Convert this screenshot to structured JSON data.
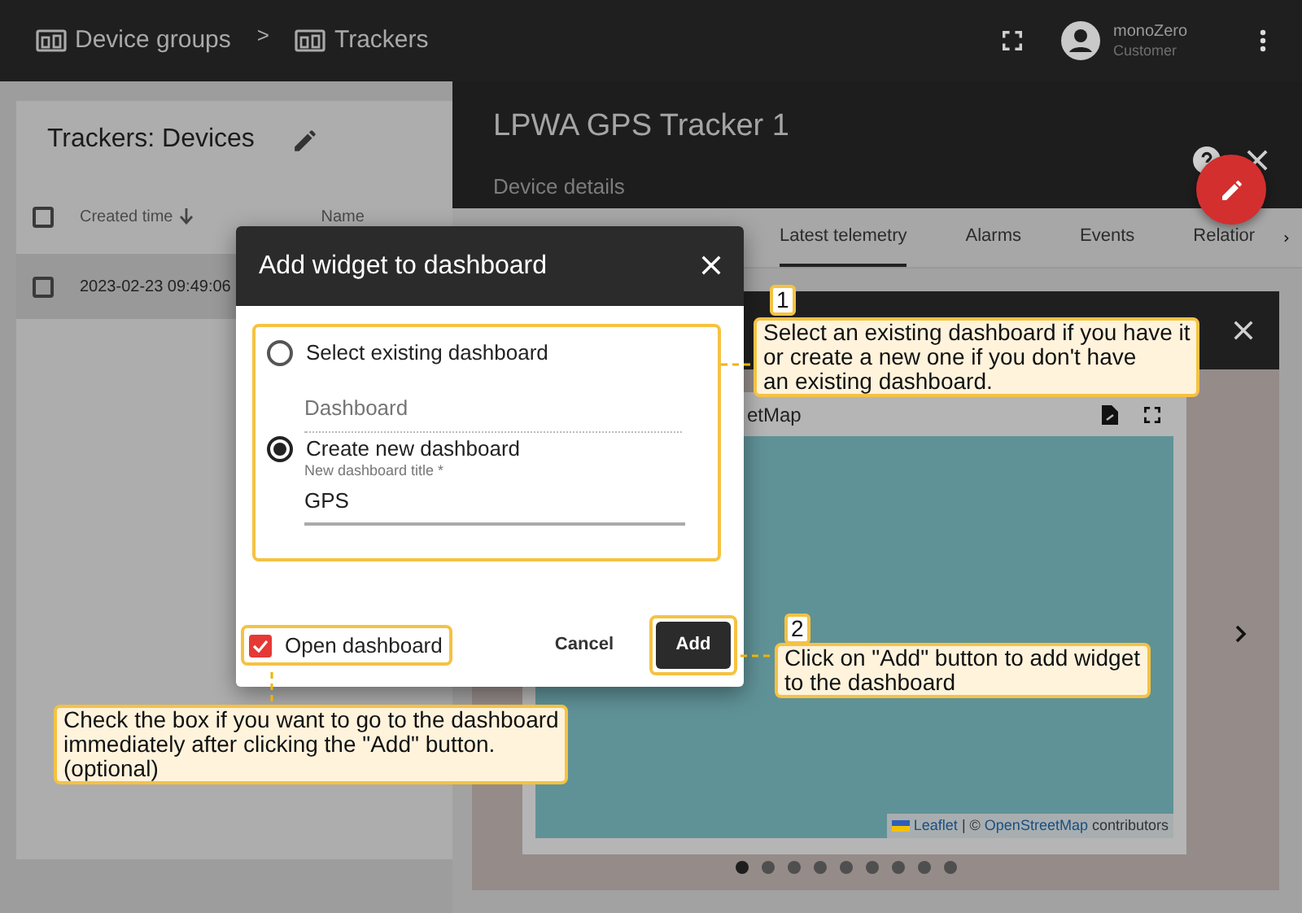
{
  "topbar": {
    "breadcrumbs": [
      {
        "label": "Device groups"
      },
      {
        "label": "Trackers"
      }
    ],
    "separator": ">",
    "user": {
      "name": "monoZero",
      "role": "Customer"
    }
  },
  "devices_card": {
    "title": "Trackers: Devices",
    "select_all_checked": false,
    "columns": [
      {
        "label": "Created time"
      },
      {
        "label": "Name"
      }
    ],
    "rows": [
      {
        "created_time": "2023-02-23 09:49:06",
        "checked": false
      }
    ]
  },
  "details": {
    "title": "LPWA GPS Tracker 1",
    "subtitle": "Device details",
    "tabs": [
      {
        "label": "Latest telemetry",
        "selected": true
      },
      {
        "label": "Alarms",
        "selected": false
      },
      {
        "label": "Events",
        "selected": false
      },
      {
        "label": "Relatior",
        "selected": false
      }
    ],
    "widget": {
      "title": "etMap",
      "attribution": {
        "link_1": "Leaflet",
        "separator": "| ©",
        "link_2": "OpenStreetMap",
        "suffix": "contributors"
      }
    },
    "pages": [
      {
        "selected": true
      },
      {
        "selected": false
      },
      {
        "selected": false
      },
      {
        "selected": false
      },
      {
        "selected": false
      },
      {
        "selected": false
      },
      {
        "selected": false
      },
      {
        "selected": false
      },
      {
        "selected": false
      }
    ]
  },
  "dialog": {
    "title": "Add widget to dashboard",
    "options": [
      {
        "kind": "select",
        "label": "Select existing dashboard",
        "selected": false,
        "placeholder": "Dashboard"
      },
      {
        "kind": "create",
        "label": "Create new dashboard",
        "selected": true,
        "field_label": "New dashboard title *",
        "value": "GPS"
      }
    ],
    "open_dashboard": {
      "label": "Open dashboard",
      "checked": true
    },
    "buttons": [
      {
        "kind": "text",
        "label": "Cancel"
      },
      {
        "kind": "primary",
        "label": "Add"
      }
    ]
  },
  "callouts": [
    {
      "number": "1",
      "lines": [
        "Select an existing dashboard if you have it",
        "or create a new one if you don't have",
        "an existing dashboard."
      ]
    },
    {
      "number": "2",
      "lines": [
        "Click on \"Add\" button to add widget",
        "to the dashboard"
      ]
    },
    {
      "lines": [
        "Check the box if you want to go to the dashboard",
        "immediately after clicking the \"Add\" button.",
        "(optional)"
      ]
    }
  ]
}
